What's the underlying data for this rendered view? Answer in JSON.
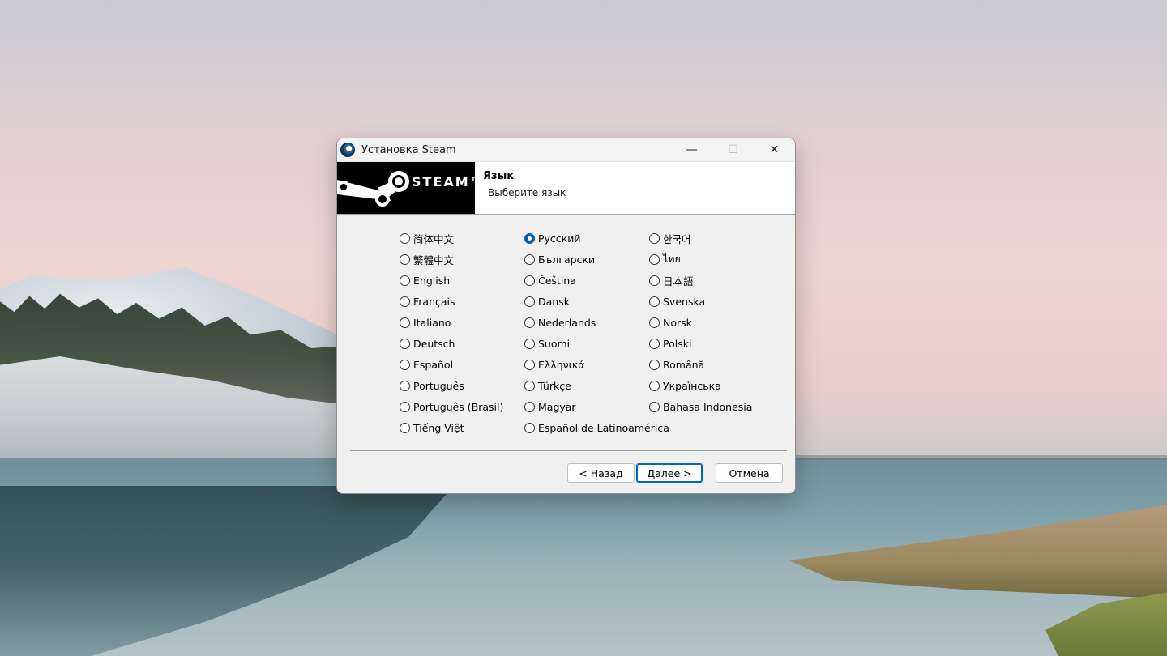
{
  "window": {
    "title": "Установка Steam",
    "controls": {
      "minimize": "—",
      "maximize": "☐",
      "close": "✕"
    }
  },
  "header": {
    "logo_text": "STEAM™",
    "title": "Язык",
    "subtitle": "Выберите язык"
  },
  "languages": [
    {
      "label": "简体中文",
      "selected": false
    },
    {
      "label": "繁體中文",
      "selected": false
    },
    {
      "label": "English",
      "selected": false
    },
    {
      "label": "Français",
      "selected": false
    },
    {
      "label": "Italiano",
      "selected": false
    },
    {
      "label": "Deutsch",
      "selected": false
    },
    {
      "label": "Español",
      "selected": false
    },
    {
      "label": "Português",
      "selected": false
    },
    {
      "label": "Português (Brasil)",
      "selected": false
    },
    {
      "label": "Tiếng Việt",
      "selected": false
    },
    {
      "label": "Русский",
      "selected": true
    },
    {
      "label": "Български",
      "selected": false
    },
    {
      "label": "Čeština",
      "selected": false
    },
    {
      "label": "Dansk",
      "selected": false
    },
    {
      "label": "Nederlands",
      "selected": false
    },
    {
      "label": "Suomi",
      "selected": false
    },
    {
      "label": "Ελληνικά",
      "selected": false
    },
    {
      "label": "Türkçe",
      "selected": false
    },
    {
      "label": "Magyar",
      "selected": false
    },
    {
      "label": "Español de Latinoamérica",
      "selected": false
    },
    {
      "label": "한국어",
      "selected": false
    },
    {
      "label": "ไทย",
      "selected": false
    },
    {
      "label": "日本語",
      "selected": false
    },
    {
      "label": "Svenska",
      "selected": false
    },
    {
      "label": "Norsk",
      "selected": false
    },
    {
      "label": "Polski",
      "selected": false
    },
    {
      "label": "Română",
      "selected": false
    },
    {
      "label": "Українська",
      "selected": false
    },
    {
      "label": "Bahasa Indonesia",
      "selected": false
    }
  ],
  "buttons": {
    "back": "< Назад",
    "next": "Далее >",
    "cancel": "Отмена"
  },
  "colors": {
    "accent": "#005fb8",
    "logo_bg": "#000000"
  }
}
